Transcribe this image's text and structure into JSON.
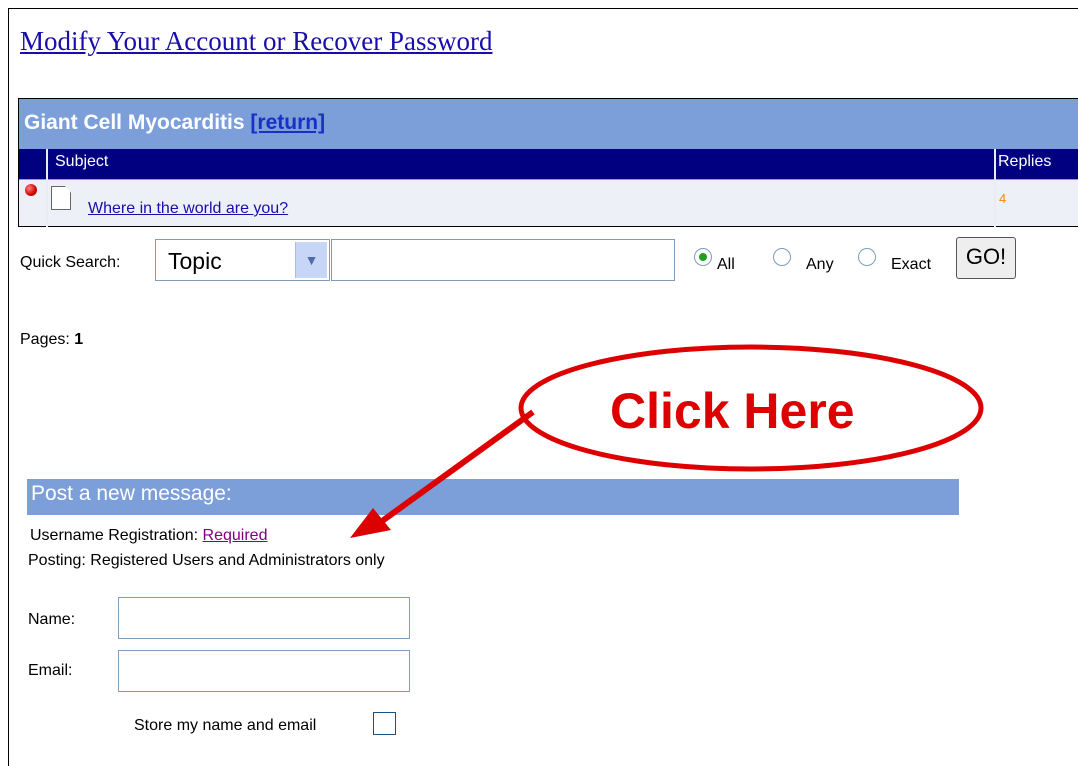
{
  "top_link": "Modify Your Account or Recover Password",
  "forum": {
    "title": "Giant Cell Myocarditis",
    "return_label": "[return]",
    "col_subject": "Subject",
    "col_replies": "Replies",
    "topic": "Where in the world are you?",
    "replies": "4"
  },
  "quick_search": {
    "label": "Quick Search:",
    "select_value": "Topic",
    "input_value": "",
    "options": [
      "All",
      "Any",
      "Exact"
    ],
    "selected": "All",
    "go_label": "GO!"
  },
  "pages": {
    "label": "Pages:",
    "value": "1"
  },
  "post": {
    "title": "Post a new message:",
    "reg_label": "Username Registration:",
    "reg_link": "Required",
    "posting": "Posting: Registered Users and Administrators only",
    "name_label": "Name:",
    "email_label": "Email:",
    "name_value": "",
    "email_value": "",
    "store_label": "Store my name and email"
  },
  "annotation": {
    "text": "Click Here",
    "color": "#dd0000"
  },
  "colors": {
    "header_blue": "#7c9fd9",
    "navy": "#000080",
    "link": "#1a0dab",
    "visited": "#800080"
  }
}
